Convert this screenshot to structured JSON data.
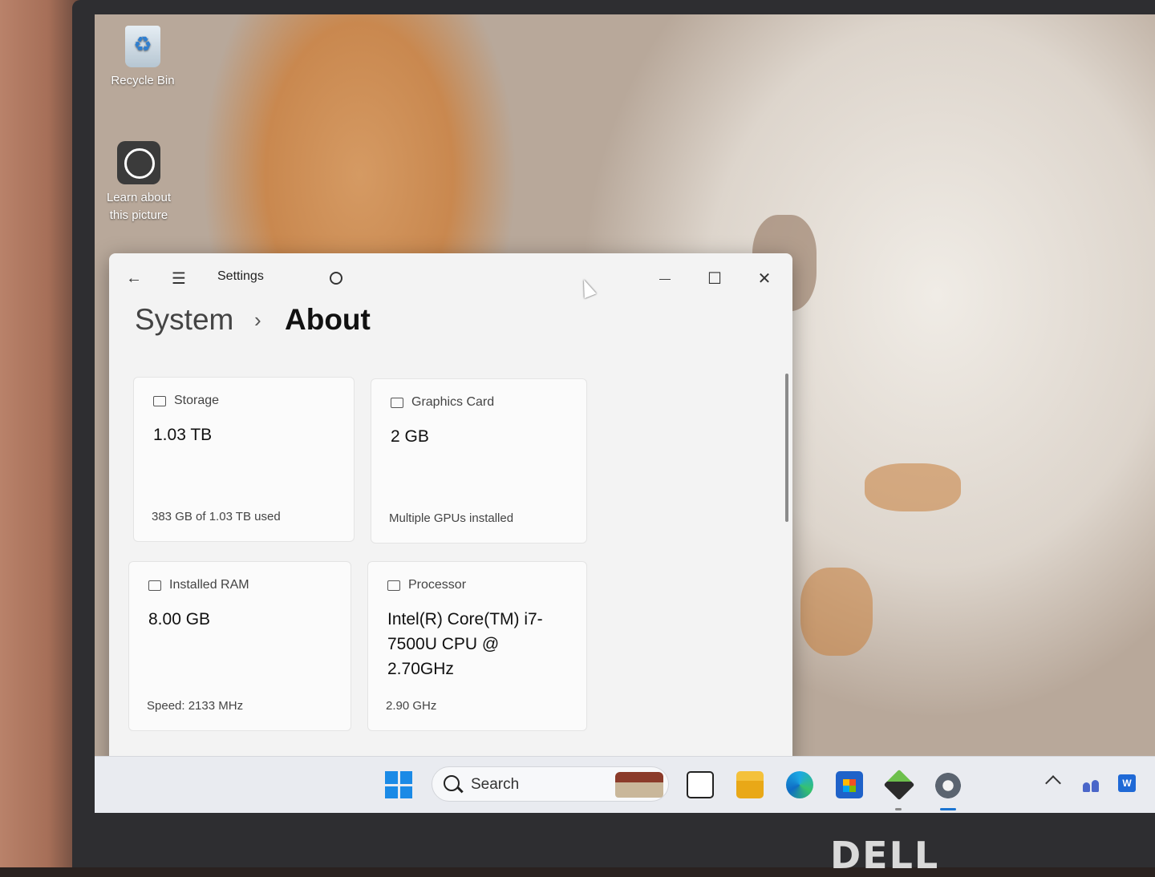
{
  "desktop": {
    "icons": [
      {
        "label": "Recycle Bin"
      },
      {
        "label_line1": "Learn about",
        "label_line2": "this picture"
      }
    ]
  },
  "window": {
    "title": "Settings",
    "breadcrumb": {
      "parent": "System",
      "separator": "›",
      "current": "About"
    },
    "cards": [
      {
        "header": "Storage",
        "value": "1.03 TB",
        "detail": "383 GB of 1.03 TB used"
      },
      {
        "header": "Graphics Card",
        "value": "2 GB",
        "detail": "Multiple GPUs installed"
      },
      {
        "header": "Installed RAM",
        "value": "8.00 GB",
        "detail": "Speed: 2133 MHz"
      },
      {
        "header": "Processor",
        "value": "Intel(R) Core(TM) i7-7500U CPU @ 2.70GHz",
        "detail": "2.90 GHz"
      }
    ],
    "controls": {
      "back": "←",
      "menu": "☰",
      "minimize": "—",
      "maximize": "☐",
      "close": "✕"
    }
  },
  "taskbar": {
    "search_label": "Search"
  },
  "colors": {
    "accent": "#1b74d1",
    "window_bg": "#f3f3f3",
    "card_bg": "#fbfbfb"
  }
}
